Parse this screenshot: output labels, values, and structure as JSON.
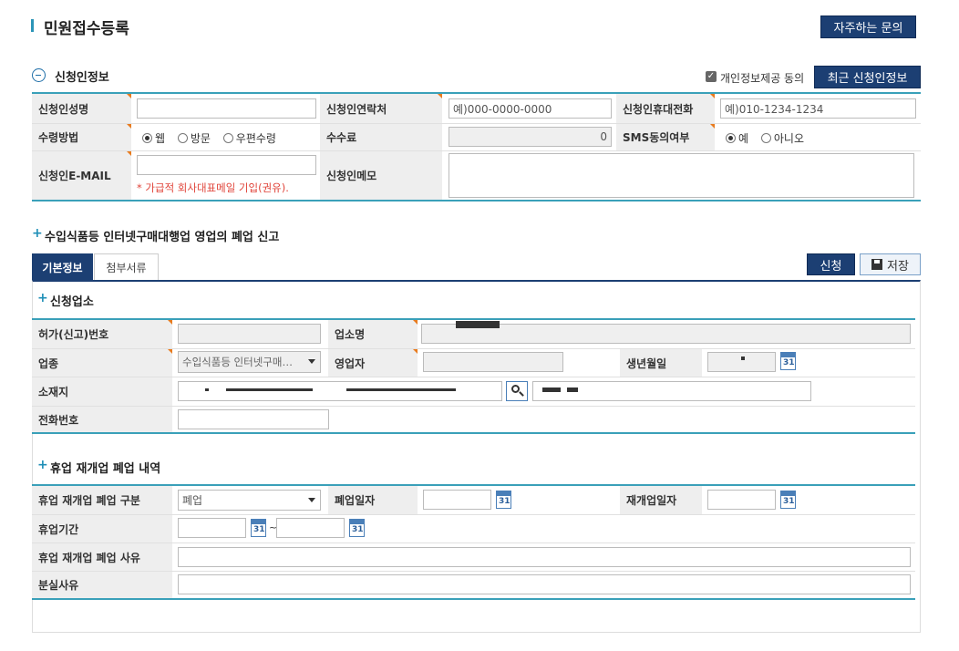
{
  "page": {
    "title": "민원접수등록",
    "faq_button": "자주하는 문의"
  },
  "applicant": {
    "section_title": "신청인정보",
    "consent_label": "개인정보제공 동의",
    "recent_button": "최근 신청인정보",
    "name_label": "신청인성명",
    "contact_label": "신청인연락처",
    "contact_placeholder": "예)000-0000-0000",
    "mobile_label": "신청인휴대전화",
    "mobile_placeholder": "예)010-1234-1234",
    "receive_label": "수령방법",
    "receive_options": [
      "웹",
      "방문",
      "우편수령"
    ],
    "fee_label": "수수료",
    "fee_value": "0",
    "sms_label": "SMS동의여부",
    "sms_options": [
      "예",
      "아니오"
    ],
    "email_label": "신청인E-MAIL",
    "email_note": "* 가급적 회사대표메일 기입(권유).",
    "memo_label": "신청인메모"
  },
  "form": {
    "title": "수입식품등 인터넷구매대행업 영업의 폐업 신고",
    "tabs": [
      "기본정보",
      "첨부서류"
    ],
    "submit_button": "신청",
    "save_button": "저장"
  },
  "business": {
    "section_title": "신청업소",
    "license_label": "허가(신고)번호",
    "name_label": "업소명",
    "type_label": "업종",
    "type_value": "수입식품등 인터넷구매…",
    "owner_label": "영업자",
    "birth_label": "생년월일",
    "address_label": "소재지",
    "phone_label": "전화번호",
    "calendar_text": "31"
  },
  "closure": {
    "section_title": "휴업 재개업 폐업 내역",
    "type_label": "휴업 재개업 폐업 구분",
    "type_value": "폐업",
    "close_date_label": "폐업일자",
    "reopen_date_label": "재개업일자",
    "period_label": "휴업기간",
    "period_sep": "~",
    "reason_label": "휴업 재개업 폐업 사유",
    "loss_label": "분실사유"
  }
}
